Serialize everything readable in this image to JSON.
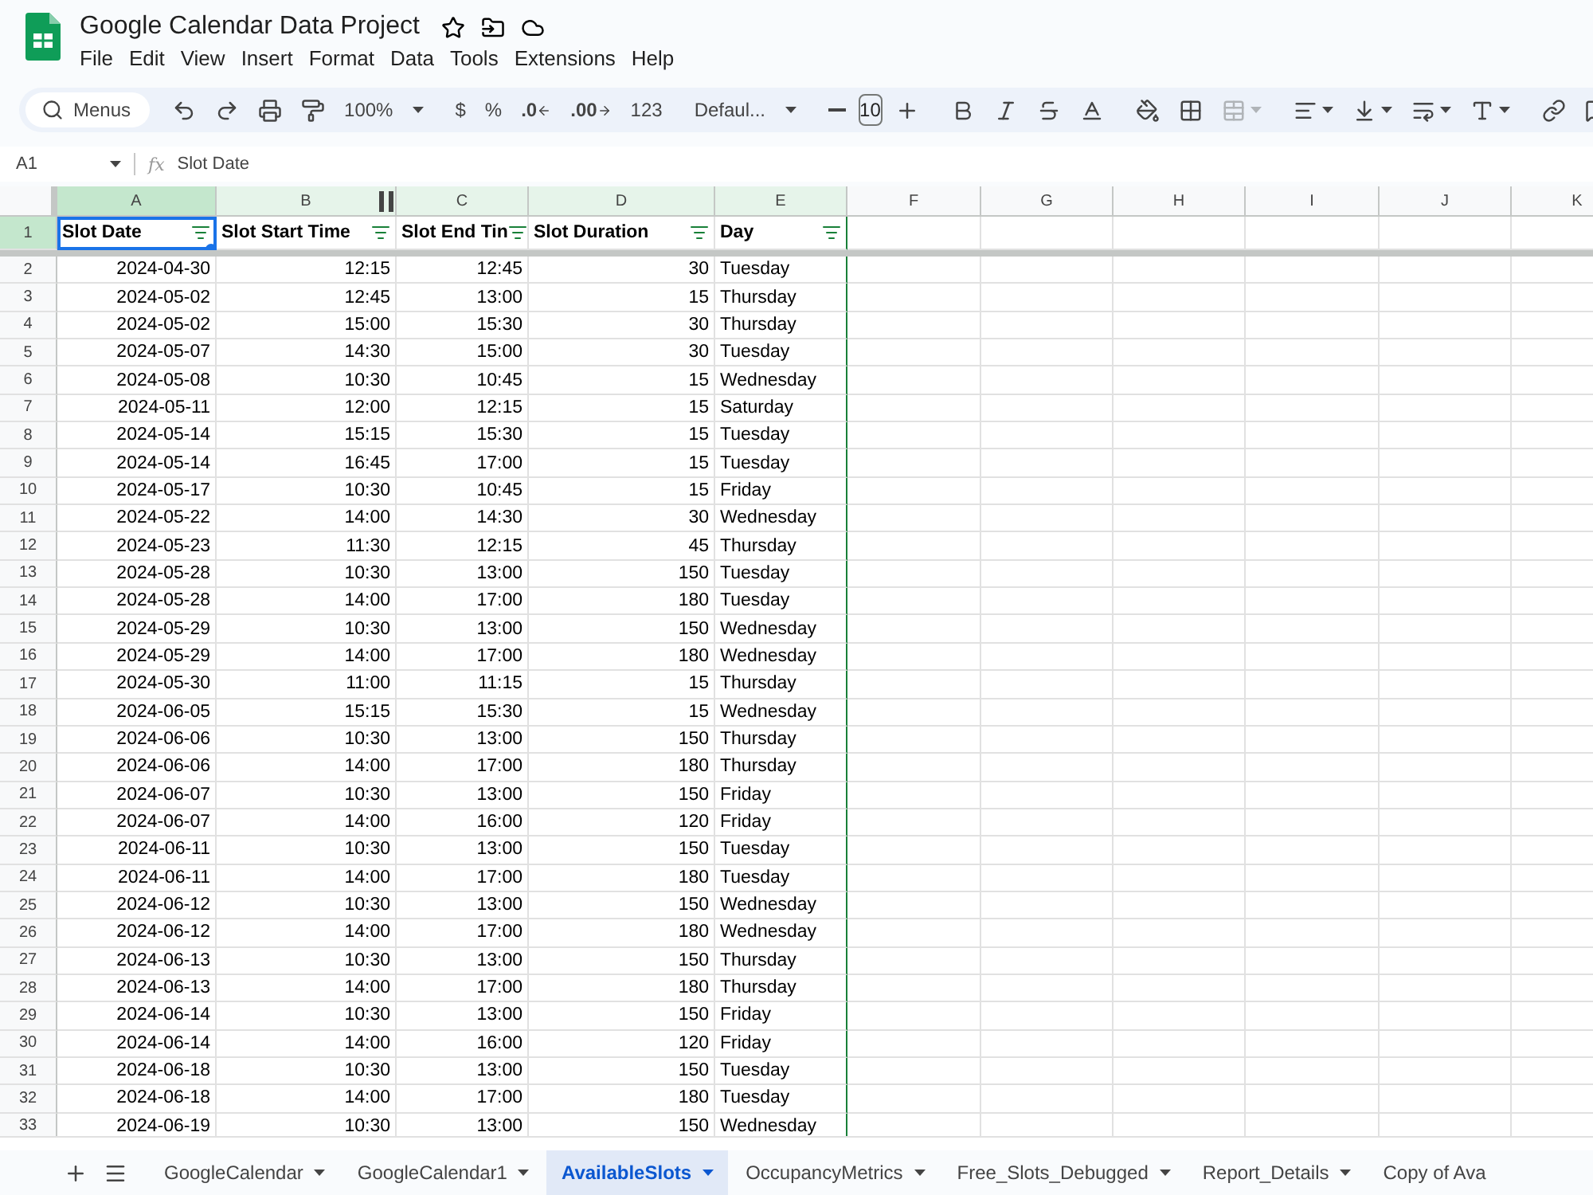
{
  "document": {
    "title": "Google Calendar Data Project"
  },
  "menu": [
    "File",
    "Edit",
    "View",
    "Insert",
    "Format",
    "Data",
    "Tools",
    "Extensions",
    "Help"
  ],
  "toolbar": [
    {
      "kind": "search",
      "label": "Menus"
    },
    {
      "kind": "undo"
    },
    {
      "kind": "redo"
    },
    {
      "kind": "print"
    },
    {
      "kind": "paint-format"
    },
    {
      "kind": "zoom",
      "label": "100%"
    },
    {
      "kind": "separator"
    },
    {
      "kind": "text",
      "label": "$"
    },
    {
      "kind": "text",
      "label": "%"
    },
    {
      "kind": "decimal-decrease",
      "label": ".0"
    },
    {
      "kind": "decimal-increase",
      "label": ".00"
    },
    {
      "kind": "text",
      "label": "123"
    },
    {
      "kind": "separator"
    },
    {
      "kind": "font",
      "label": "Defaul..."
    },
    {
      "kind": "separator"
    },
    {
      "kind": "minus"
    },
    {
      "kind": "font-size",
      "label": "10"
    },
    {
      "kind": "plus"
    },
    {
      "kind": "separator"
    },
    {
      "kind": "bold"
    },
    {
      "kind": "italic"
    },
    {
      "kind": "strike"
    },
    {
      "kind": "text-color"
    },
    {
      "kind": "separator"
    },
    {
      "kind": "fill"
    },
    {
      "kind": "borders"
    },
    {
      "kind": "merge"
    },
    {
      "kind": "separator"
    },
    {
      "kind": "align"
    },
    {
      "kind": "valign"
    },
    {
      "kind": "wrap"
    },
    {
      "kind": "rotate"
    },
    {
      "kind": "separator"
    },
    {
      "kind": "link"
    },
    {
      "kind": "comment"
    }
  ],
  "name_box": "A1",
  "formula_label": "fx",
  "formula": "Slot Date",
  "columns": [
    {
      "label": "A",
      "selected": true,
      "filtered": true
    },
    {
      "label": "B",
      "selected": false,
      "filtered": true
    },
    {
      "label": "C",
      "selected": false,
      "filtered": true
    },
    {
      "label": "D",
      "selected": false,
      "filtered": true
    },
    {
      "label": "E",
      "selected": false,
      "filtered": true
    },
    {
      "label": "F",
      "selected": false,
      "filtered": false
    },
    {
      "label": "G",
      "selected": false,
      "filtered": false
    },
    {
      "label": "H",
      "selected": false,
      "filtered": false
    },
    {
      "label": "I",
      "selected": false,
      "filtered": false
    },
    {
      "label": "J",
      "selected": false,
      "filtered": false
    },
    {
      "label": "K",
      "selected": false,
      "filtered": false
    }
  ],
  "header_row": {
    "number": "1",
    "selected": true,
    "cells": [
      "Slot Date",
      "Slot Start Time",
      "Slot End Tin",
      "Slot Duration",
      "Day"
    ]
  },
  "rows": [
    {
      "number": "2",
      "cells": [
        "2024-04-30",
        "12:15",
        "12:45",
        "30",
        "Tuesday"
      ]
    },
    {
      "number": "3",
      "cells": [
        "2024-05-02",
        "12:45",
        "13:00",
        "15",
        "Thursday"
      ]
    },
    {
      "number": "4",
      "cells": [
        "2024-05-02",
        "15:00",
        "15:30",
        "30",
        "Thursday"
      ]
    },
    {
      "number": "5",
      "cells": [
        "2024-05-07",
        "14:30",
        "15:00",
        "30",
        "Tuesday"
      ]
    },
    {
      "number": "6",
      "cells": [
        "2024-05-08",
        "10:30",
        "10:45",
        "15",
        "Wednesday"
      ]
    },
    {
      "number": "7",
      "cells": [
        "2024-05-11",
        "12:00",
        "12:15",
        "15",
        "Saturday"
      ]
    },
    {
      "number": "8",
      "cells": [
        "2024-05-14",
        "15:15",
        "15:30",
        "15",
        "Tuesday"
      ]
    },
    {
      "number": "9",
      "cells": [
        "2024-05-14",
        "16:45",
        "17:00",
        "15",
        "Tuesday"
      ]
    },
    {
      "number": "10",
      "cells": [
        "2024-05-17",
        "10:30",
        "10:45",
        "15",
        "Friday"
      ]
    },
    {
      "number": "11",
      "cells": [
        "2024-05-22",
        "14:00",
        "14:30",
        "30",
        "Wednesday"
      ]
    },
    {
      "number": "12",
      "cells": [
        "2024-05-23",
        "11:30",
        "12:15",
        "45",
        "Thursday"
      ]
    },
    {
      "number": "13",
      "cells": [
        "2024-05-28",
        "10:30",
        "13:00",
        "150",
        "Tuesday"
      ]
    },
    {
      "number": "14",
      "cells": [
        "2024-05-28",
        "14:00",
        "17:00",
        "180",
        "Tuesday"
      ]
    },
    {
      "number": "15",
      "cells": [
        "2024-05-29",
        "10:30",
        "13:00",
        "150",
        "Wednesday"
      ]
    },
    {
      "number": "16",
      "cells": [
        "2024-05-29",
        "14:00",
        "17:00",
        "180",
        "Wednesday"
      ]
    },
    {
      "number": "17",
      "cells": [
        "2024-05-30",
        "11:00",
        "11:15",
        "15",
        "Thursday"
      ]
    },
    {
      "number": "18",
      "cells": [
        "2024-06-05",
        "15:15",
        "15:30",
        "15",
        "Wednesday"
      ]
    },
    {
      "number": "19",
      "cells": [
        "2024-06-06",
        "10:30",
        "13:00",
        "150",
        "Thursday"
      ]
    },
    {
      "number": "20",
      "cells": [
        "2024-06-06",
        "14:00",
        "17:00",
        "180",
        "Thursday"
      ]
    },
    {
      "number": "21",
      "cells": [
        "2024-06-07",
        "10:30",
        "13:00",
        "150",
        "Friday"
      ]
    },
    {
      "number": "22",
      "cells": [
        "2024-06-07",
        "14:00",
        "16:00",
        "120",
        "Friday"
      ]
    },
    {
      "number": "23",
      "cells": [
        "2024-06-11",
        "10:30",
        "13:00",
        "150",
        "Tuesday"
      ]
    },
    {
      "number": "24",
      "cells": [
        "2024-06-11",
        "14:00",
        "17:00",
        "180",
        "Tuesday"
      ]
    },
    {
      "number": "25",
      "cells": [
        "2024-06-12",
        "10:30",
        "13:00",
        "150",
        "Wednesday"
      ]
    },
    {
      "number": "26",
      "cells": [
        "2024-06-12",
        "14:00",
        "17:00",
        "180",
        "Wednesday"
      ]
    },
    {
      "number": "27",
      "cells": [
        "2024-06-13",
        "10:30",
        "13:00",
        "150",
        "Thursday"
      ]
    },
    {
      "number": "28",
      "cells": [
        "2024-06-13",
        "14:00",
        "17:00",
        "180",
        "Thursday"
      ]
    },
    {
      "number": "29",
      "cells": [
        "2024-06-14",
        "10:30",
        "13:00",
        "150",
        "Friday"
      ]
    },
    {
      "number": "30",
      "cells": [
        "2024-06-14",
        "14:00",
        "16:00",
        "120",
        "Friday"
      ]
    },
    {
      "number": "31",
      "cells": [
        "2024-06-18",
        "10:30",
        "13:00",
        "150",
        "Tuesday"
      ]
    },
    {
      "number": "32",
      "cells": [
        "2024-06-18",
        "14:00",
        "17:00",
        "180",
        "Tuesday"
      ]
    },
    {
      "number": "33",
      "cells": [
        "2024-06-19",
        "10:30",
        "13:00",
        "150",
        "Wednesday"
      ]
    }
  ],
  "sheets": [
    {
      "label": "GoogleCalendar",
      "selected": false
    },
    {
      "label": "GoogleCalendar1",
      "selected": false
    },
    {
      "label": "AvailableSlots",
      "selected": true
    },
    {
      "label": "OccupancyMetrics",
      "selected": false
    },
    {
      "label": "Free_Slots_Debugged",
      "selected": false
    },
    {
      "label": "Report_Details",
      "selected": false
    },
    {
      "label": "Copy of Ava",
      "selected": false
    }
  ]
}
